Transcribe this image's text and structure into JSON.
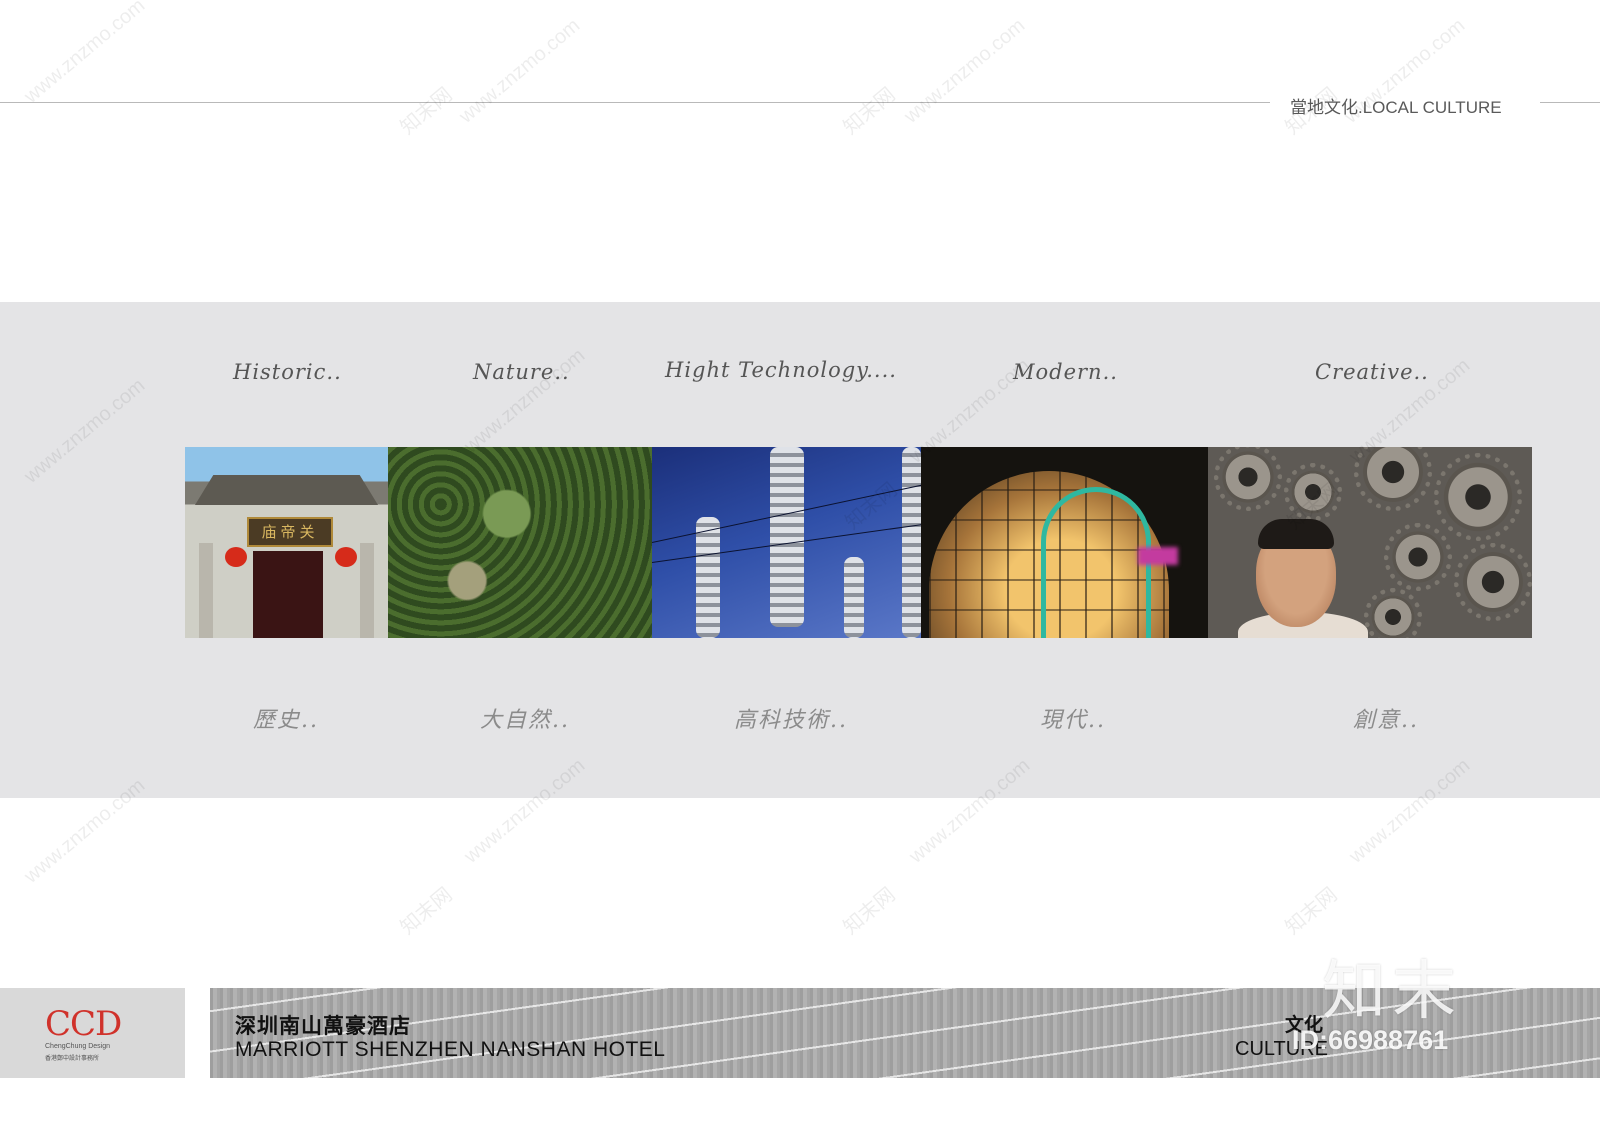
{
  "header": {
    "title": "當地文化.LOCAL CULTURE"
  },
  "columns": [
    {
      "en": "Historic..",
      "zh": "歷史..",
      "photo": "temple-gate-photo"
    },
    {
      "en": "Nature..",
      "zh": "大自然..",
      "photo": "forest-photo"
    },
    {
      "en": "Hight Technology....",
      "zh": "高科技術..",
      "photo": "insulators-photo"
    },
    {
      "en": "Modern..",
      "zh": "現代..",
      "photo": "glass-building-photo"
    },
    {
      "en": "Creative..",
      "zh": "創意..",
      "photo": "gears-portrait-photo"
    }
  ],
  "photo_text": {
    "plaque": "庙帝关"
  },
  "logo": {
    "name": "CCD",
    "sub": "ChengChung Design",
    "sub2": "香港鄭中設計事務所"
  },
  "footer": {
    "hotel_zh": "深圳南山萬豪酒店",
    "hotel_en": "MARRIOTT SHENZHEN NANSHAN HOTEL",
    "section_zh": "文化",
    "section_en": "CULTURE"
  },
  "watermark": {
    "site": "www.znzmo.com",
    "brand": "知末网",
    "logo": "知末",
    "id": "ID:66988761"
  },
  "colors": {
    "band": "#e4e4e6",
    "logo_red": "#d0322b"
  }
}
